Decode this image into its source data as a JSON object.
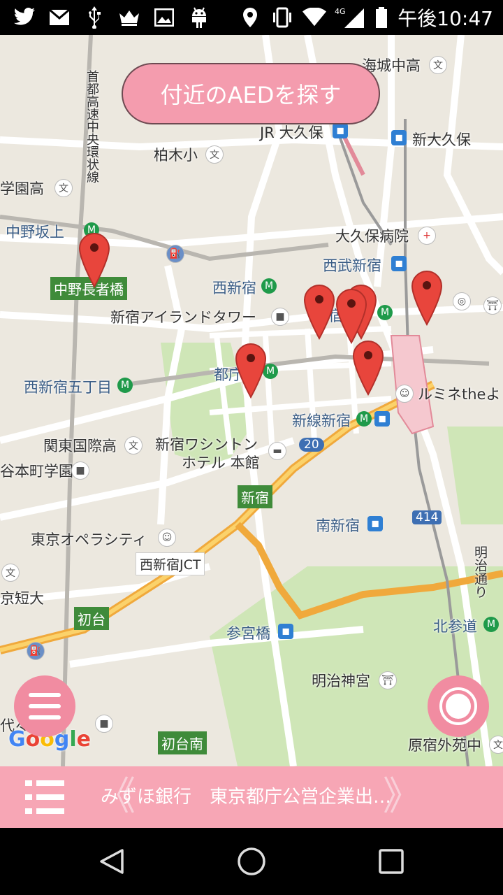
{
  "status_bar": {
    "time": "午後10:47",
    "network": "4G",
    "icons": [
      "twitter-icon",
      "mail-icon",
      "usb-icon",
      "crown-icon",
      "image-icon",
      "android-icon",
      "location-icon",
      "vibrate-icon",
      "wifi-icon",
      "signal-icon",
      "battery-icon"
    ]
  },
  "search_button": {
    "label": "付近のAEDを探す"
  },
  "map": {
    "labels": {
      "shuto_expressway": "首都高速中央環状線",
      "kaijo_high": "海城中高",
      "jr_okubo": "JR 大久保",
      "shin_okubo": "新大久保",
      "kashiwagi_elem": "柏木小",
      "gakuen_high": "学園高",
      "nakano_sakaue": "中野坂上",
      "okubo_hospital": "大久保病院",
      "seibu_shinjuku": "西武新宿",
      "nakano_choja": "中野長者橋",
      "nishi_shinjuku": "西新宿",
      "island_tower": "新宿アイランドタワー",
      "shinjuku_station": "宿",
      "tocho": "都庁",
      "lumine": "ルミネtheよ",
      "nishi_shinjuku_5": "西新宿五丁目",
      "shinsen_shinjuku": "新線新宿",
      "kanto_kokusai": "関東国際高",
      "washington_hotel_1": "新宿ワシントン",
      "washington_hotel_2": "ホテル 本館",
      "route_20": "20",
      "honmachi": "谷本町学園",
      "shinjuku_sign": "新宿",
      "minami_shinjuku": "南新宿",
      "route_414": "414",
      "tokyo_opera": "東京オペラシティ",
      "nishi_shinjuku_jct": "西新宿JCT",
      "meiji_dori": "明治通り",
      "tanki_daigaku": "京短大",
      "hatsudai": "初台",
      "kita_sando": "北参道",
      "sangubashi": "参宮橋",
      "meiji_jingu": "明治神宮",
      "yoyogi_school": "代々木校",
      "hatsudai_minami": "初台南",
      "harajuku_gaien": "原宿外苑中"
    },
    "pin_count": 7,
    "pin_color": "#e8453c"
  },
  "menu_fab": {
    "icon": "menu-icon"
  },
  "location_fab": {
    "icon": "target-icon"
  },
  "google_logo": "Google",
  "bottom_bar": {
    "list_icon": "list-icon",
    "marquee_text": "みずほ銀行　東京都庁公営企業出…",
    "prev_chevron": "《",
    "next_chevron": "》"
  },
  "nav_bar": {
    "back_icon": "back-triangle-icon",
    "home_icon": "home-circle-icon",
    "recents_icon": "recents-square-icon"
  },
  "colors": {
    "accent_pink": "#f49cae",
    "bottom_bar_pink": "#f7a6b5",
    "map_background": "#ece8df"
  }
}
